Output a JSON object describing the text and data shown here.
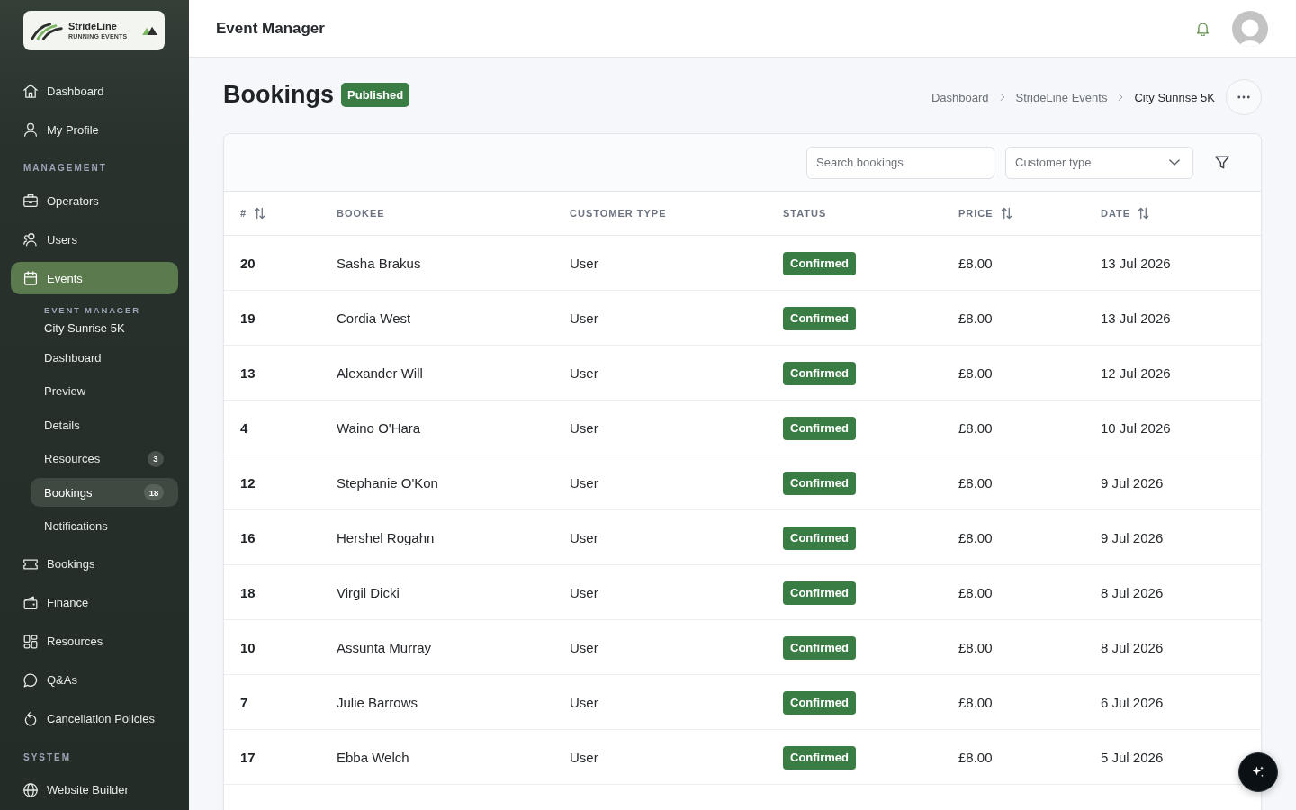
{
  "sidebar": {
    "logo": {
      "name": "StrideLine",
      "tagline": "RUNNING EVENTS"
    },
    "nav": [
      {
        "kind": "link",
        "label": "Dashboard",
        "selected": false
      },
      {
        "kind": "link",
        "label": "My Profile",
        "selected": false
      },
      {
        "kind": "heading",
        "label": "MANAGEMENT"
      },
      {
        "kind": "link",
        "label": "Operators",
        "selected": false
      },
      {
        "kind": "link",
        "label": "Users",
        "selected": false
      },
      {
        "kind": "link",
        "label": "Events",
        "selected": true
      },
      {
        "kind": "submenu",
        "heading": "EVENT MANAGER",
        "title": "City Sunrise 5K",
        "items": [
          {
            "label": "Dashboard",
            "selected": false
          },
          {
            "label": "Preview",
            "selected": false
          },
          {
            "label": "Details",
            "selected": false
          },
          {
            "label": "Resources",
            "count": "3",
            "selected": false
          },
          {
            "label": "Bookings",
            "count": "18",
            "selected": true
          },
          {
            "label": "Notifications",
            "selected": false
          }
        ]
      },
      {
        "kind": "link",
        "label": "Bookings",
        "selected": false
      },
      {
        "kind": "link",
        "label": "Finance",
        "selected": false
      },
      {
        "kind": "link",
        "label": "Resources",
        "selected": false
      },
      {
        "kind": "link",
        "label": "Q&As",
        "selected": false
      },
      {
        "kind": "link",
        "label": "Cancellation Policies",
        "selected": false
      },
      {
        "kind": "heading",
        "label": "SYSTEM"
      },
      {
        "kind": "link",
        "label": "Website Builder",
        "selected": false
      }
    ]
  },
  "header": {
    "title": "Event Manager"
  },
  "page": {
    "title": "Bookings",
    "status": "Published",
    "breadcrumb": [
      {
        "label": "Dashboard",
        "current": false
      },
      {
        "label": "StrideLine Events",
        "current": false
      },
      {
        "label": "City Sunrise 5K",
        "current": true
      }
    ]
  },
  "toolbar": {
    "search": {
      "placeholder": "Search bookings"
    },
    "customer_type": {
      "placeholder": "Customer type"
    }
  },
  "table": {
    "columns": [
      {
        "label": "#",
        "sortable": true
      },
      {
        "label": "BOOKEE",
        "sortable": false
      },
      {
        "label": "CUSTOMER TYPE",
        "sortable": false
      },
      {
        "label": "STATUS",
        "sortable": false
      },
      {
        "label": "PRICE",
        "sortable": true
      },
      {
        "label": "DATE",
        "sortable": true
      }
    ],
    "rows": [
      {
        "id": "20",
        "bookee": "Sasha Brakus",
        "customer_type": "User",
        "status": "Confirmed",
        "price": "£8.00",
        "date": "13 Jul 2026"
      },
      {
        "id": "19",
        "bookee": "Cordia West",
        "customer_type": "User",
        "status": "Confirmed",
        "price": "£8.00",
        "date": "13 Jul 2026"
      },
      {
        "id": "13",
        "bookee": "Alexander Will",
        "customer_type": "User",
        "status": "Confirmed",
        "price": "£8.00",
        "date": "12 Jul 2026"
      },
      {
        "id": "4",
        "bookee": "Waino O'Hara",
        "customer_type": "User",
        "status": "Confirmed",
        "price": "£8.00",
        "date": "10 Jul 2026"
      },
      {
        "id": "12",
        "bookee": "Stephanie O'Kon",
        "customer_type": "User",
        "status": "Confirmed",
        "price": "£8.00",
        "date": "9 Jul 2026"
      },
      {
        "id": "16",
        "bookee": "Hershel Rogahn",
        "customer_type": "User",
        "status": "Confirmed",
        "price": "£8.00",
        "date": "9 Jul 2026"
      },
      {
        "id": "18",
        "bookee": "Virgil Dicki",
        "customer_type": "User",
        "status": "Confirmed",
        "price": "£8.00",
        "date": "8 Jul 2026"
      },
      {
        "id": "10",
        "bookee": "Assunta Murray",
        "customer_type": "User",
        "status": "Confirmed",
        "price": "£8.00",
        "date": "8 Jul 2026"
      },
      {
        "id": "7",
        "bookee": "Julie Barrows",
        "customer_type": "User",
        "status": "Confirmed",
        "price": "£8.00",
        "date": "6 Jul 2026"
      },
      {
        "id": "17",
        "bookee": "Ebba Welch",
        "customer_type": "User",
        "status": "Confirmed",
        "price": "£8.00",
        "date": "5 Jul 2026"
      }
    ]
  }
}
